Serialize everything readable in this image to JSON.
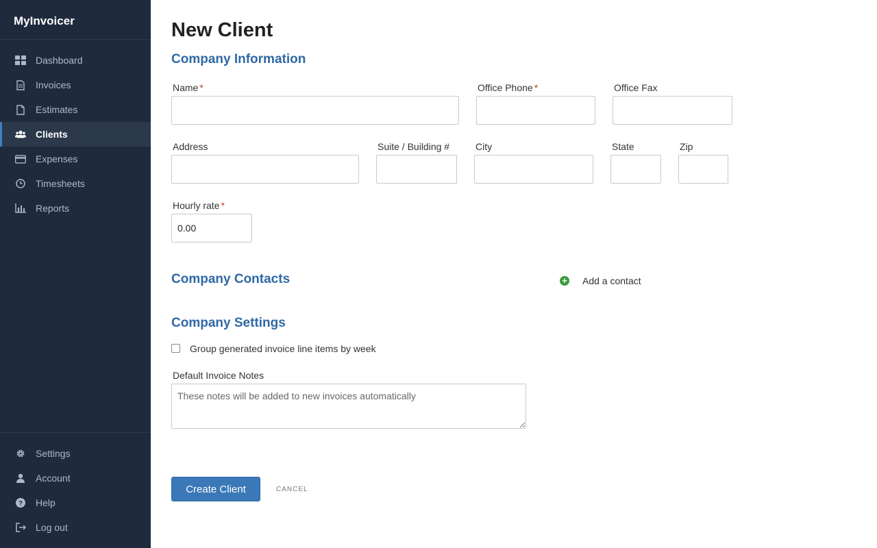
{
  "app": {
    "name": "MyInvoicer"
  },
  "sidebar": {
    "items": [
      {
        "label": "Dashboard",
        "icon": "dashboard-icon"
      },
      {
        "label": "Invoices",
        "icon": "invoice-icon"
      },
      {
        "label": "Estimates",
        "icon": "estimate-icon"
      },
      {
        "label": "Clients",
        "icon": "users-icon",
        "active": true
      },
      {
        "label": "Expenses",
        "icon": "credit-card-icon"
      },
      {
        "label": "Timesheets",
        "icon": "clock-icon"
      },
      {
        "label": "Reports",
        "icon": "bar-chart-icon"
      }
    ],
    "bottom_items": [
      {
        "label": "Settings",
        "icon": "gear-icon"
      },
      {
        "label": "Account",
        "icon": "user-icon"
      },
      {
        "label": "Help",
        "icon": "help-icon"
      },
      {
        "label": "Log out",
        "icon": "logout-icon"
      }
    ]
  },
  "page": {
    "title": "New Client"
  },
  "company_info": {
    "title": "Company Information",
    "name_label": "Name",
    "office_phone_label": "Office Phone",
    "office_fax_label": "Office Fax",
    "address_label": "Address",
    "suite_label": "Suite / Building #",
    "city_label": "City",
    "state_label": "State",
    "zip_label": "Zip",
    "hourly_rate_label": "Hourly rate",
    "hourly_rate_value": "0.00",
    "required_mark": "*"
  },
  "company_contacts": {
    "title": "Company Contacts",
    "add_label": "Add a contact",
    "add_icon_glyph": "+"
  },
  "company_settings": {
    "title": "Company Settings",
    "group_checkbox_label": "Group generated invoice line items by week",
    "group_checked": false,
    "notes_label": "Default Invoice Notes",
    "notes_placeholder": "These notes will be added to new invoices automatically"
  },
  "actions": {
    "create_label": "Create Client",
    "cancel_label": "CANCEL"
  },
  "colors": {
    "sidebar_bg": "#1f2b3c",
    "accent": "#3069a5",
    "primary_button": "#3a78b8",
    "required": "#c0392b",
    "add_icon": "#3d9a3d"
  }
}
